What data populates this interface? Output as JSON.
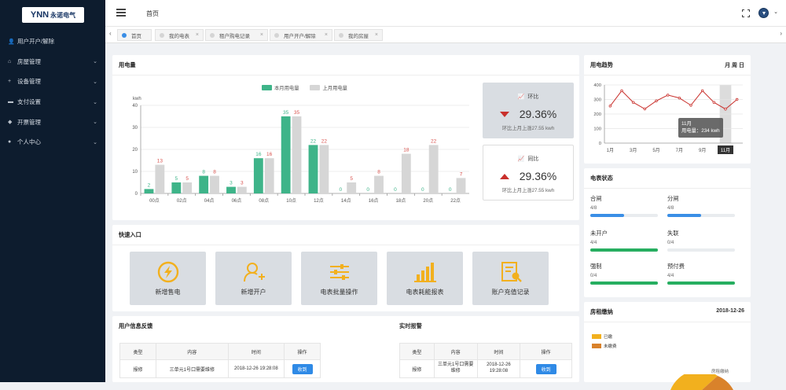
{
  "logo": {
    "brand": "YNN",
    "name": "永诺电气"
  },
  "sidebar": {
    "items": [
      {
        "label": "用户开户/解除",
        "icon": "user-icon",
        "expandable": false
      },
      {
        "label": "房屋管理",
        "icon": "home-icon",
        "expandable": true
      },
      {
        "label": "设备管理",
        "icon": "plus-icon",
        "expandable": true
      },
      {
        "label": "支付设置",
        "icon": "card-icon",
        "expandable": true
      },
      {
        "label": "开票管理",
        "icon": "tag-icon",
        "expandable": true
      },
      {
        "label": "个人中心",
        "icon": "person-icon",
        "expandable": true
      }
    ]
  },
  "header": {
    "crumb": "首页"
  },
  "tabs": [
    {
      "label": "首页",
      "active": true
    },
    {
      "label": "我的电表",
      "active": false
    },
    {
      "label": "租户购电记录",
      "active": false
    },
    {
      "label": "用户开户/解除",
      "active": false
    },
    {
      "label": "我的房屋",
      "active": false
    }
  ],
  "usage": {
    "title": "用电量",
    "stat1": {
      "label": "环比",
      "value": "29.36%",
      "sub": "环比上月上涨27.55 kwh",
      "direction": "down"
    },
    "stat2": {
      "label": "同比",
      "value": "29.36%",
      "sub": "环比上月上涨27.55 kwh",
      "direction": "up"
    }
  },
  "chart_data": [
    {
      "type": "bar",
      "ylabel": "kwh",
      "ylim": [
        0,
        40
      ],
      "yticks": [
        0,
        10,
        20,
        30,
        40
      ],
      "categories": [
        "00点",
        "02点",
        "04点",
        "06点",
        "08点",
        "10点",
        "12点",
        "14点",
        "16点",
        "18点",
        "20点",
        "22点"
      ],
      "series": [
        {
          "name": "本月用电量",
          "color": "#3eb489",
          "values": [
            2,
            5,
            8,
            3,
            16,
            35,
            22,
            0,
            0,
            0,
            0,
            0
          ]
        },
        {
          "name": "上月用电量",
          "color": "#d6d6d6",
          "values": [
            13,
            5,
            8,
            3,
            16,
            35,
            22,
            5,
            8,
            18,
            22,
            7
          ]
        }
      ],
      "legend": "top-center"
    },
    {
      "type": "line",
      "title": "用电趋势",
      "ylim": [
        0,
        400
      ],
      "yticks": [
        0,
        100,
        200,
        300,
        400
      ],
      "x": [
        "1月",
        "2月",
        "3月",
        "4月",
        "5月",
        "6月",
        "7月",
        "8月",
        "9月",
        "10月",
        "11月",
        "12月"
      ],
      "xticks": [
        "1月",
        "3月",
        "5月",
        "7月",
        "9月",
        "11月"
      ],
      "series": [
        {
          "color": "#c9302c",
          "values": [
            255,
            360,
            280,
            235,
            290,
            330,
            310,
            260,
            360,
            280,
            234,
            300
          ]
        }
      ],
      "highlight": {
        "index": 10,
        "label": "11月"
      },
      "tooltip": {
        "title": "11月",
        "text": "用电量：234 kwh"
      }
    }
  ],
  "trend": {
    "title": "用电趋势",
    "periods": "月 周 日"
  },
  "meter_status": {
    "title": "电表状态",
    "items": [
      {
        "label": "合闸",
        "value": "4/8",
        "fraction": 0.5,
        "color": "#3a8ee6"
      },
      {
        "label": "分闸",
        "value": "4/8",
        "fraction": 0.5,
        "color": "#3a8ee6"
      },
      {
        "label": "未开户",
        "value": "4/4",
        "fraction": 1,
        "color": "#27ae60"
      },
      {
        "label": "失联",
        "value": "0/4",
        "fraction": 0,
        "color": "#27ae60"
      },
      {
        "label": "强制",
        "value": "0/4",
        "fraction": 1,
        "color": "#27ae60"
      },
      {
        "label": "预付费",
        "value": "4/4",
        "fraction": 1,
        "color": "#27ae60"
      }
    ]
  },
  "quick": {
    "title": "快速入口",
    "items": [
      {
        "label": "新增售电",
        "icon": "lightning-icon"
      },
      {
        "label": "新增开户",
        "icon": "user-add-icon"
      },
      {
        "label": "电表批量操作",
        "icon": "sliders-icon"
      },
      {
        "label": "电表耗能报表",
        "icon": "bar-chart-icon"
      },
      {
        "label": "账户充值记录",
        "icon": "document-search-icon"
      }
    ]
  },
  "feedback": {
    "title": "用户信息反馈",
    "headers": [
      "类型",
      "内容",
      "时间",
      "操作"
    ],
    "rows": [
      {
        "type": "报修",
        "content": "三单元1号口需要维修",
        "time": "2018-12-26 19:28:08",
        "action": "收到"
      }
    ]
  },
  "alerts": {
    "title": "实时报警",
    "headers": [
      "类型",
      "内容",
      "时间",
      "操作"
    ],
    "rows": [
      {
        "type": "报修",
        "content": "三单元1号口需要维修",
        "time": "2018-12-26 19:28:08",
        "action": "收到"
      }
    ]
  },
  "rent": {
    "title": "房租缴纳",
    "date": "2018-12-26",
    "legend": [
      {
        "label": "已缴",
        "color": "#f2b01e"
      },
      {
        "label": "未缴费",
        "color": "#d9822b"
      }
    ],
    "sub": "房租缴纳"
  }
}
